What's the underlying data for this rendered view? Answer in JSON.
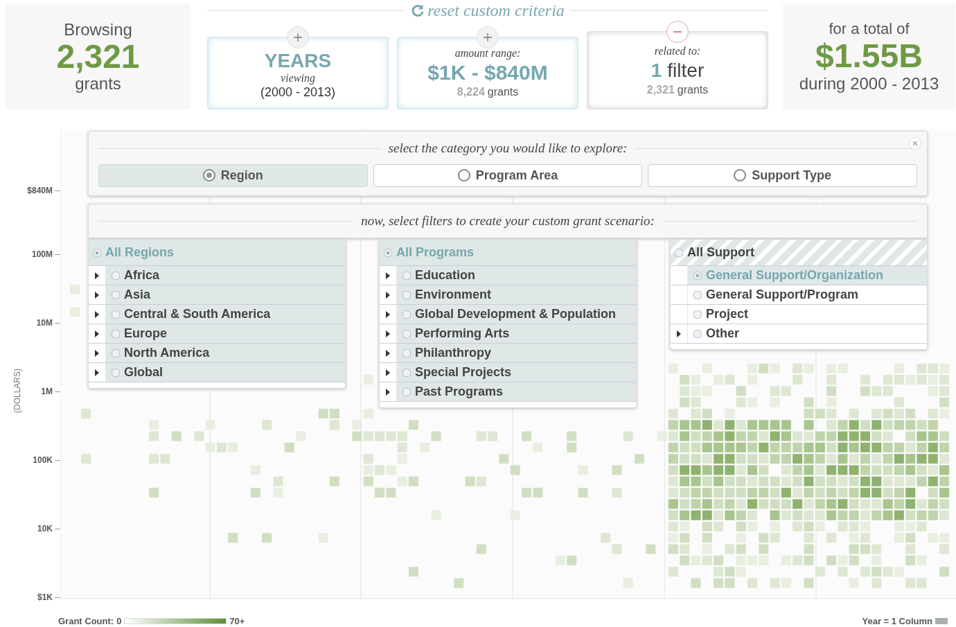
{
  "summary_left": {
    "label": "Browsing",
    "count": "2,321",
    "unit": "grants"
  },
  "reset": {
    "label": "reset custom criteria"
  },
  "criteria": [
    {
      "kind": "years",
      "removable": false,
      "title": "YEARS",
      "caption": "viewing",
      "detail": "(2000 - 2013)"
    },
    {
      "kind": "amount",
      "removable": false,
      "caption": "amount range:",
      "value": "$1K - $840M",
      "count": "8,224",
      "unit": "grants"
    },
    {
      "kind": "related",
      "removable": true,
      "caption": "related to:",
      "number": "1",
      "word": "filter",
      "count": "2,321",
      "unit": "grants"
    }
  ],
  "summary_right": {
    "label": "for a total of",
    "amount": "$1.55B",
    "period": "during 2000 - 2013"
  },
  "y_axis": {
    "title": "(DOLLARS)",
    "ticks": [
      "$840M",
      "100M",
      "10M",
      "1M",
      "100K",
      "10K",
      "$1K"
    ]
  },
  "category_panel": {
    "prompt": "select the category you would like to explore:",
    "options": [
      {
        "label": "Region",
        "selected": true
      },
      {
        "label": "Program Area",
        "selected": false
      },
      {
        "label": "Support Type",
        "selected": false
      }
    ]
  },
  "filter_panel": {
    "prompt": "now, select filters to create your custom grant scenario:"
  },
  "filter_lists": [
    {
      "header": {
        "label": "All Regions",
        "checked": true
      },
      "items": [
        {
          "label": "Africa",
          "checked": false,
          "expandable": true
        },
        {
          "label": "Asia",
          "checked": false,
          "expandable": true
        },
        {
          "label": "Central & South America",
          "checked": false,
          "expandable": true
        },
        {
          "label": "Europe",
          "checked": false,
          "expandable": true
        },
        {
          "label": "North America",
          "checked": false,
          "expandable": true
        },
        {
          "label": "Global",
          "checked": false,
          "expandable": true
        }
      ]
    },
    {
      "header": {
        "label": "All Programs",
        "checked": true
      },
      "items": [
        {
          "label": "Education",
          "checked": false,
          "expandable": true
        },
        {
          "label": "Environment",
          "checked": false,
          "expandable": true
        },
        {
          "label": "Global Development & Population",
          "checked": false,
          "expandable": true
        },
        {
          "label": "Performing Arts",
          "checked": false,
          "expandable": true
        },
        {
          "label": "Philanthropy",
          "checked": false,
          "expandable": true
        },
        {
          "label": "Special Projects",
          "checked": false,
          "expandable": true
        },
        {
          "label": "Past Programs",
          "checked": false,
          "expandable": true
        }
      ]
    },
    {
      "header": {
        "label": "All Support",
        "checked": false
      },
      "items": [
        {
          "label": "General Support/Organization",
          "checked": true,
          "expandable": false
        },
        {
          "label": "General Support/Program",
          "checked": false,
          "expandable": false
        },
        {
          "label": "Project",
          "checked": false,
          "expandable": false
        },
        {
          "label": "Other",
          "checked": false,
          "expandable": true
        }
      ]
    }
  ],
  "legend": {
    "label": "Grant Count:",
    "min": "0",
    "max": "70+"
  },
  "column_legend": {
    "label": "Year = 1 Column"
  }
}
